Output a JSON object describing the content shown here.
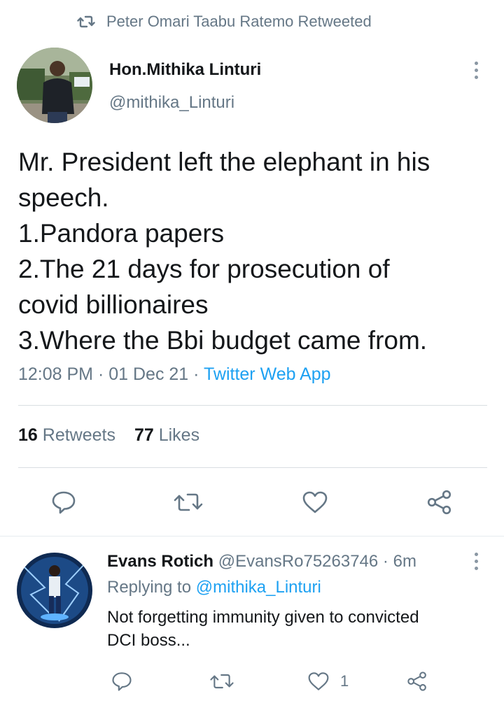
{
  "retweet_banner": {
    "text": "Peter Omari Taabu Ratemo Retweeted",
    "icon": "retweet-icon"
  },
  "tweet": {
    "author_name": "Hon.Mithika Linturi",
    "author_handle": "@mithika_Linturi",
    "lines": [
      "Mr. President left the elephant in his",
      "speech.",
      "1.Pandora papers",
      "2.The 21 days for prosecution of",
      "covid billionaires",
      "3.Where the Bbi budget came from."
    ],
    "time": "12:08 PM",
    "date": "01 Dec 21",
    "sep": "·",
    "source": "Twitter Web App",
    "retweets_count": "16",
    "retweets_label": "Retweets",
    "likes_count": "77",
    "likes_label": "Likes"
  },
  "reply": {
    "author_name": "Evans Rotich",
    "author_handle": "@EvansRo75263746",
    "sep": "·",
    "time_ago": "6m",
    "replying_prefix": "Replying to",
    "replying_handle": "@mithika_Linturi",
    "lines": [
      "Not forgetting immunity given to convicted",
      "DCI boss..."
    ],
    "like_count": "1"
  },
  "colors": {
    "accent": "#1da1f2",
    "secondary_text": "#657786",
    "primary_text": "#14171a",
    "divider": "#d9dee2"
  }
}
